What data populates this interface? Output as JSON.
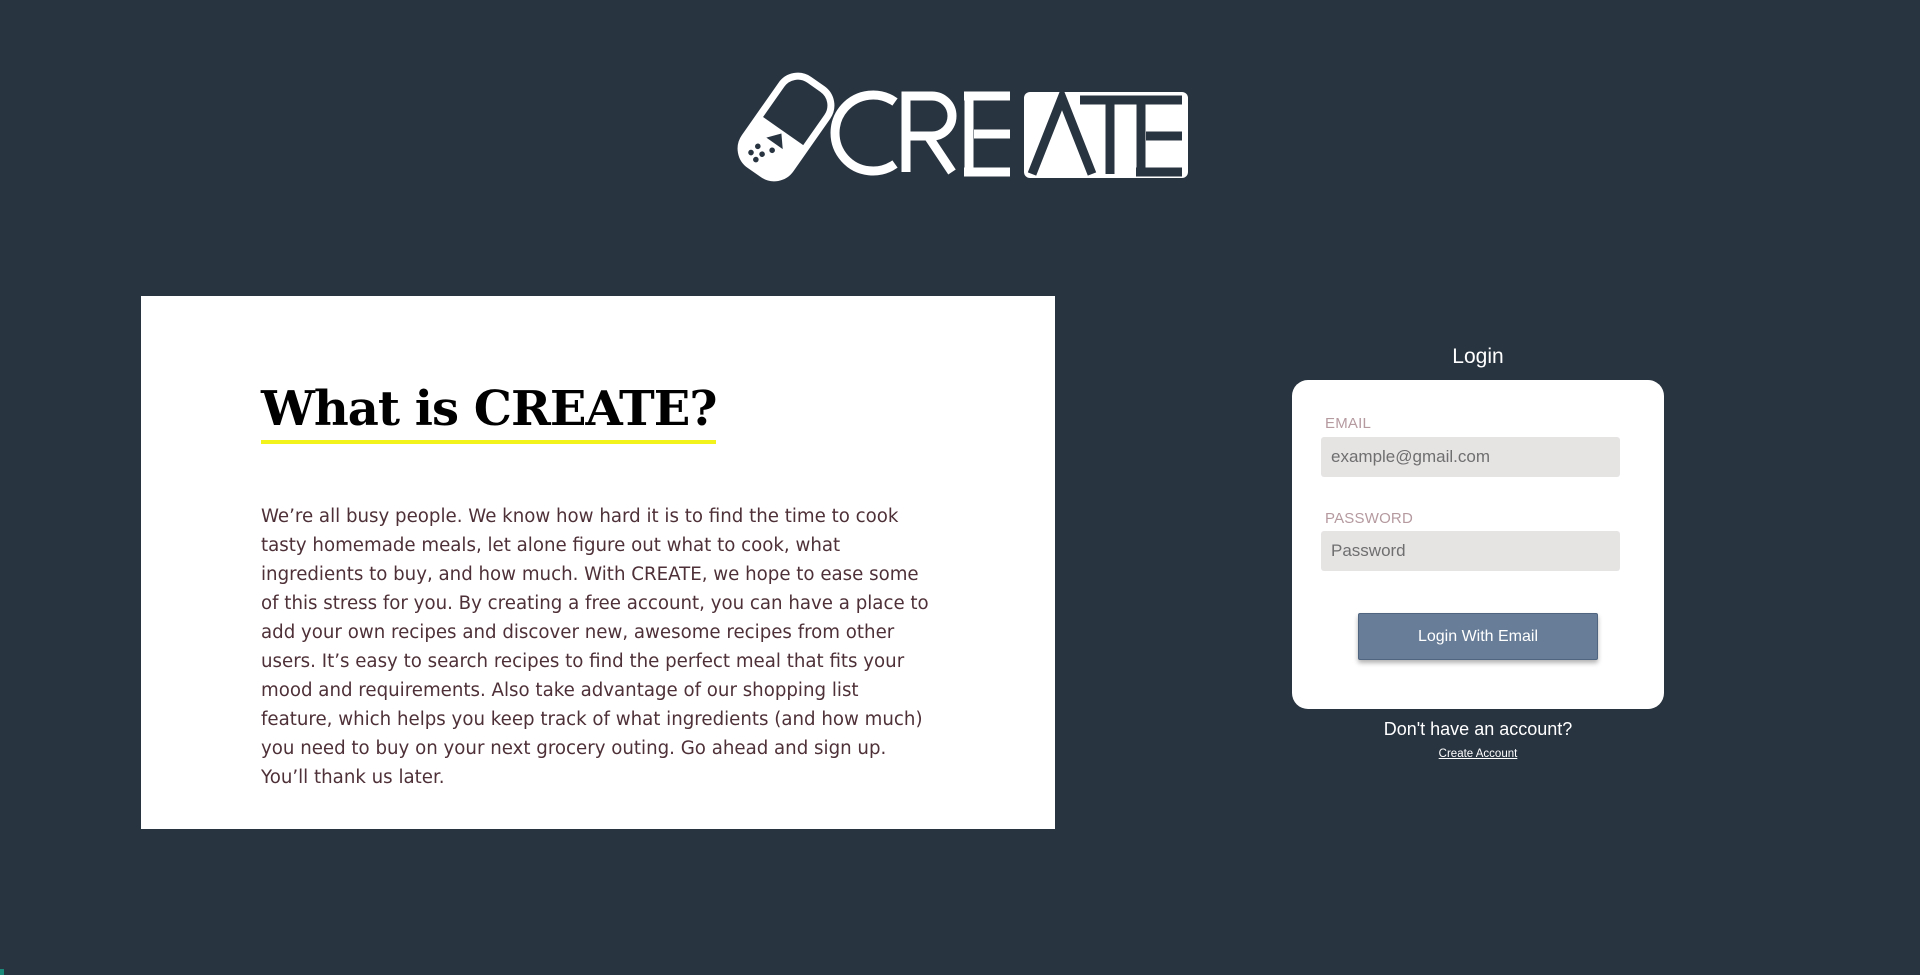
{
  "logo": {
    "text": "CREATE"
  },
  "about": {
    "title": "What is CREATE?",
    "body": "We’re all busy people. We know how hard it is to find the time to cook tasty homemade meals, let alone figure out what to cook, what ingredients to buy, and how much. With CREATE, we hope to ease some of this stress for you. By creating a free account, you can have a place to add your own recipes and discover new, awesome recipes from other users. It’s easy to search recipes to find the perfect meal that fits your mood and requirements. Also take advantage of our shopping list feature, which helps you keep track of what ingredients (and how much) you need to buy on your next grocery outing. Go ahead and sign up. You’ll thank us later."
  },
  "login": {
    "heading": "Login",
    "email_label": "EMAIL",
    "email_placeholder": "example@gmail.com",
    "email_value": "",
    "password_label": "PASSWORD",
    "password_placeholder": "Password",
    "password_value": "",
    "submit_label": "Login With Email"
  },
  "signup": {
    "prompt": "Don't have an account?",
    "link_label": "Create Account"
  },
  "colors": {
    "background": "#293441",
    "accent_underline": "#f2f21c",
    "button": "#677d98",
    "body_text": "#4e3138"
  }
}
